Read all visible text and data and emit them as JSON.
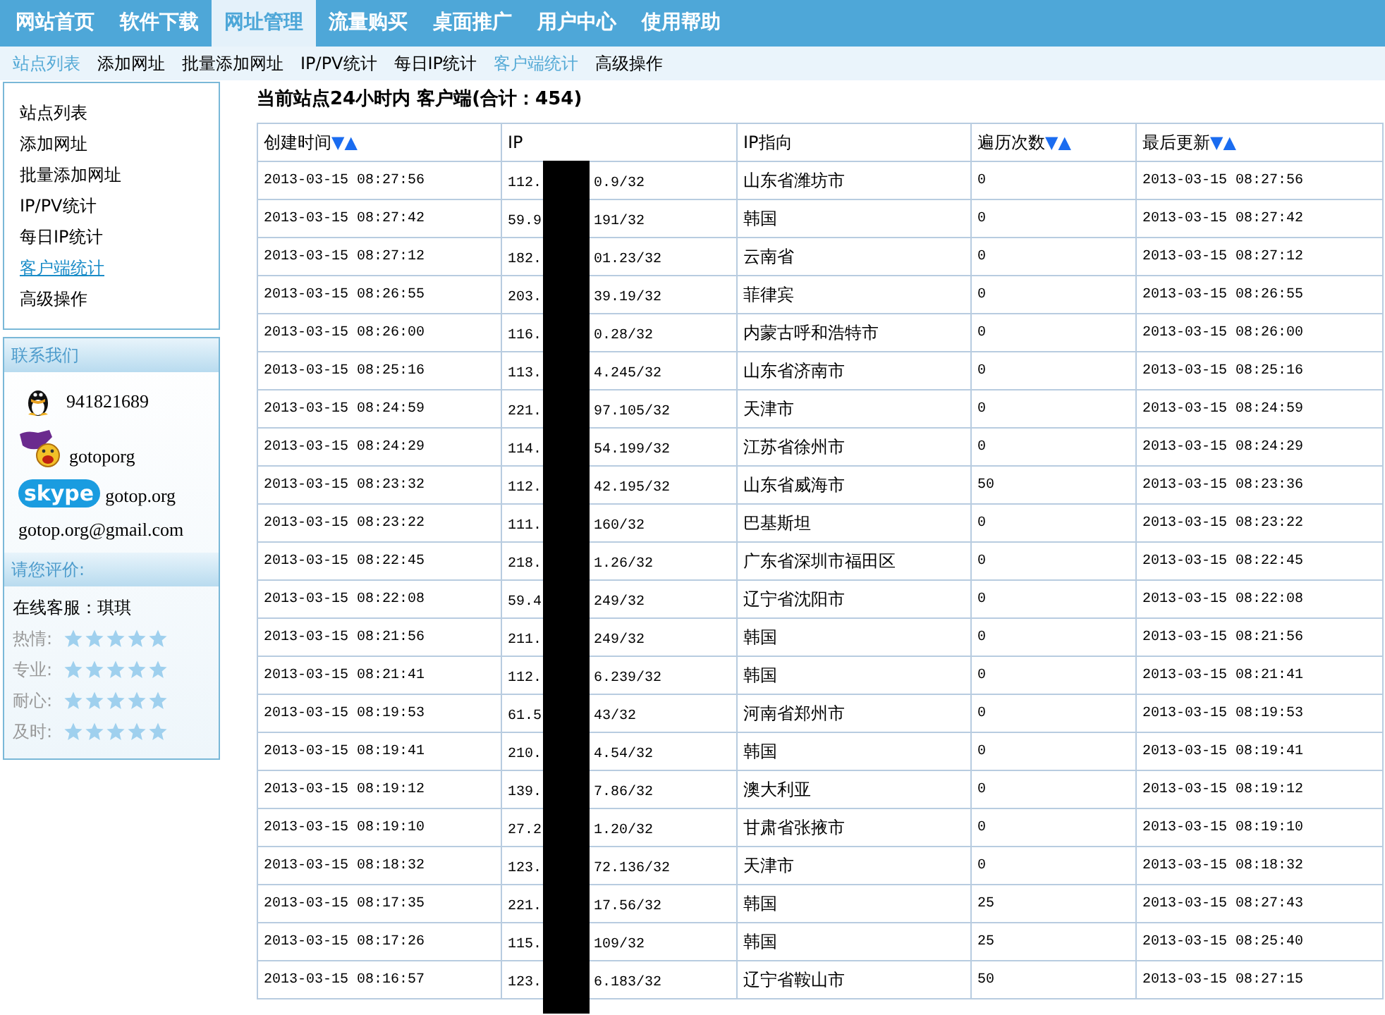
{
  "nav": [
    {
      "label": "网站首页",
      "selected": false
    },
    {
      "label": "软件下载",
      "selected": false
    },
    {
      "label": "网址管理",
      "selected": true
    },
    {
      "label": "流量购买",
      "selected": false
    },
    {
      "label": "桌面推广",
      "selected": false
    },
    {
      "label": "用户中心",
      "selected": false
    },
    {
      "label": "使用帮助",
      "selected": false
    }
  ],
  "subnav": [
    {
      "label": "站点列表",
      "active": true
    },
    {
      "label": "添加网址",
      "active": false
    },
    {
      "label": "批量添加网址",
      "active": false
    },
    {
      "label": "IP/PV统计",
      "active": false
    },
    {
      "label": "每日IP统计",
      "active": false
    },
    {
      "label": "客户端统计",
      "active": true
    },
    {
      "label": "高级操作",
      "active": false
    }
  ],
  "sidebar": {
    "menu": [
      {
        "label": "站点列表",
        "selected": false
      },
      {
        "label": "添加网址",
        "selected": false
      },
      {
        "label": "批量添加网址",
        "selected": false
      },
      {
        "label": "IP/PV统计",
        "selected": false
      },
      {
        "label": "每日IP统计",
        "selected": false
      },
      {
        "label": "客户端统计",
        "selected": true
      },
      {
        "label": "高级操作",
        "selected": false
      }
    ],
    "contact": {
      "title": "联系我们",
      "items": [
        {
          "kind": "qq",
          "text": "941821689"
        },
        {
          "kind": "yahoo",
          "text": "gotoporg"
        },
        {
          "kind": "skype",
          "logo": "skype",
          "text": "gotop.org"
        },
        {
          "kind": "email",
          "text": "gotop.org@gmail.com"
        }
      ]
    },
    "rating": {
      "title": "请您评价:",
      "agent": "在线客服：琪琪",
      "rows": [
        {
          "label": "热情:"
        },
        {
          "label": "专业:"
        },
        {
          "label": "耐心:"
        },
        {
          "label": "及时:"
        }
      ]
    }
  },
  "title": "当前站点24小时内 客户端(合计：454)",
  "table": {
    "columns": [
      {
        "label": "创建时间",
        "sort_desc": "▼",
        "sort_asc": "▲"
      },
      {
        "label": "IP"
      },
      {
        "label": "IP指向"
      },
      {
        "label": "遍历次数",
        "sort_desc": "▼",
        "sort_asc": "▲"
      },
      {
        "label": "最后更新",
        "sort_desc": "▼",
        "sort_asc": "▲"
      }
    ],
    "rows": [
      {
        "created": "2013-03-15 08:27:56",
        "ip_start": "112.",
        "ip_end": "0.9/32",
        "location": "山东省潍坊市",
        "count": "0",
        "updated": "2013-03-15 08:27:56"
      },
      {
        "created": "2013-03-15 08:27:42",
        "ip_start": "59.9",
        "ip_end": "191/32",
        "location": "韩国",
        "count": "0",
        "updated": "2013-03-15 08:27:42"
      },
      {
        "created": "2013-03-15 08:27:12",
        "ip_start": "182.",
        "ip_end": "01.23/32",
        "location": "云南省",
        "count": "0",
        "updated": "2013-03-15 08:27:12"
      },
      {
        "created": "2013-03-15 08:26:55",
        "ip_start": "203.",
        "ip_end": "39.19/32",
        "location": "菲律宾",
        "count": "0",
        "updated": "2013-03-15 08:26:55"
      },
      {
        "created": "2013-03-15 08:26:00",
        "ip_start": "116.",
        "ip_end": "0.28/32",
        "location": "内蒙古呼和浩特市",
        "count": "0",
        "updated": "2013-03-15 08:26:00"
      },
      {
        "created": "2013-03-15 08:25:16",
        "ip_start": "113.",
        "ip_end": "4.245/32",
        "location": "山东省济南市",
        "count": "0",
        "updated": "2013-03-15 08:25:16"
      },
      {
        "created": "2013-03-15 08:24:59",
        "ip_start": "221.",
        "ip_end": "97.105/32",
        "location": "天津市",
        "count": "0",
        "updated": "2013-03-15 08:24:59"
      },
      {
        "created": "2013-03-15 08:24:29",
        "ip_start": "114.",
        "ip_end": "54.199/32",
        "location": "江苏省徐州市",
        "count": "0",
        "updated": "2013-03-15 08:24:29"
      },
      {
        "created": "2013-03-15 08:23:32",
        "ip_start": "112.",
        "ip_end": "42.195/32",
        "location": "山东省威海市",
        "count": "50",
        "updated": "2013-03-15 08:23:36"
      },
      {
        "created": "2013-03-15 08:23:22",
        "ip_start": "111.",
        "ip_end": "160/32",
        "location": "巴基斯坦",
        "count": "0",
        "updated": "2013-03-15 08:23:22"
      },
      {
        "created": "2013-03-15 08:22:45",
        "ip_start": "218.",
        "ip_end": "1.26/32",
        "location": "广东省深圳市福田区",
        "count": "0",
        "updated": "2013-03-15 08:22:45"
      },
      {
        "created": "2013-03-15 08:22:08",
        "ip_start": "59.4",
        "ip_end": "249/32",
        "location": "辽宁省沈阳市",
        "count": "0",
        "updated": "2013-03-15 08:22:08"
      },
      {
        "created": "2013-03-15 08:21:56",
        "ip_start": "211.",
        "ip_end": "249/32",
        "location": "韩国",
        "count": "0",
        "updated": "2013-03-15 08:21:56"
      },
      {
        "created": "2013-03-15 08:21:41",
        "ip_start": "112.",
        "ip_end": "6.239/32",
        "location": "韩国",
        "count": "0",
        "updated": "2013-03-15 08:21:41"
      },
      {
        "created": "2013-03-15 08:19:53",
        "ip_start": "61.5",
        "ip_end": "43/32",
        "location": "河南省郑州市",
        "count": "0",
        "updated": "2013-03-15 08:19:53"
      },
      {
        "created": "2013-03-15 08:19:41",
        "ip_start": "210.",
        "ip_end": "4.54/32",
        "location": "韩国",
        "count": "0",
        "updated": "2013-03-15 08:19:41"
      },
      {
        "created": "2013-03-15 08:19:12",
        "ip_start": "139.",
        "ip_end": "7.86/32",
        "location": "澳大利亚",
        "count": "0",
        "updated": "2013-03-15 08:19:12"
      },
      {
        "created": "2013-03-15 08:19:10",
        "ip_start": "27.2",
        "ip_end": "1.20/32",
        "location": "甘肃省张掖市",
        "count": "0",
        "updated": "2013-03-15 08:19:10"
      },
      {
        "created": "2013-03-15 08:18:32",
        "ip_start": "123.",
        "ip_end": "72.136/32",
        "location": "天津市",
        "count": "0",
        "updated": "2013-03-15 08:18:32"
      },
      {
        "created": "2013-03-15 08:17:35",
        "ip_start": "221.",
        "ip_end": "17.56/32",
        "location": "韩国",
        "count": "25",
        "updated": "2013-03-15 08:27:43"
      },
      {
        "created": "2013-03-15 08:17:26",
        "ip_start": "115.",
        "ip_end": "109/32",
        "location": "韩国",
        "count": "25",
        "updated": "2013-03-15 08:25:40"
      },
      {
        "created": "2013-03-15 08:16:57",
        "ip_start": "123.",
        "ip_end": "6.183/32",
        "location": "辽宁省鞍山市",
        "count": "50",
        "updated": "2013-03-15 08:27:15"
      }
    ]
  }
}
